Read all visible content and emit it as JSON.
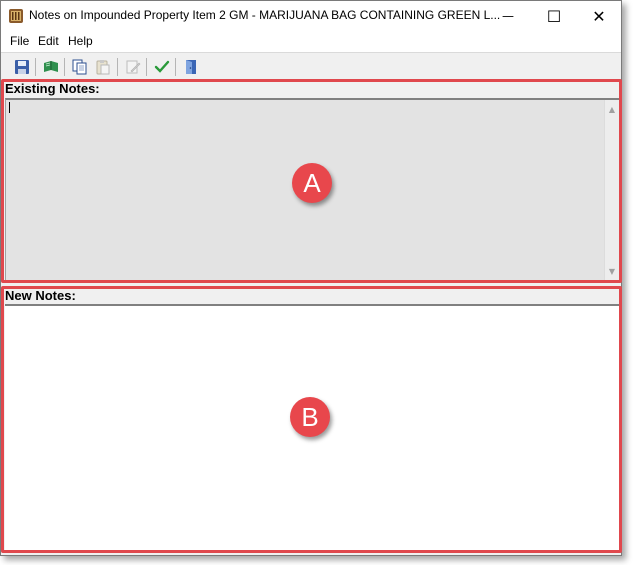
{
  "window": {
    "title": "Notes on Impounded Property Item 2 GM - MARIJUANA BAG CONTAINING GREEN L...",
    "minimize_glyph": "—",
    "maximize_glyph": "☐",
    "close_glyph": "✕"
  },
  "menu": {
    "items": [
      {
        "label": "File"
      },
      {
        "label": "Edit"
      },
      {
        "label": "Help"
      }
    ]
  },
  "toolbar": {
    "buttons": [
      {
        "icon": "save-icon",
        "enabled": true
      },
      {
        "icon": "open-book-icon",
        "enabled": true
      },
      {
        "icon": "copy-icon",
        "enabled": true
      },
      {
        "icon": "paste-icon",
        "enabled": false
      },
      {
        "icon": "edit-icon",
        "enabled": false
      },
      {
        "icon": "checkmark-icon",
        "enabled": true
      },
      {
        "icon": "exit-door-icon",
        "enabled": true
      }
    ]
  },
  "sections": {
    "existing_label": "Existing Notes:",
    "new_label": "New Notes:"
  },
  "callouts": {
    "a": "A",
    "b": "B"
  },
  "colors": {
    "highlight": "#e0484d",
    "callout_fill": "#e8474c",
    "existing_bg": "#e3e3e3",
    "new_bg": "#ffffff"
  }
}
